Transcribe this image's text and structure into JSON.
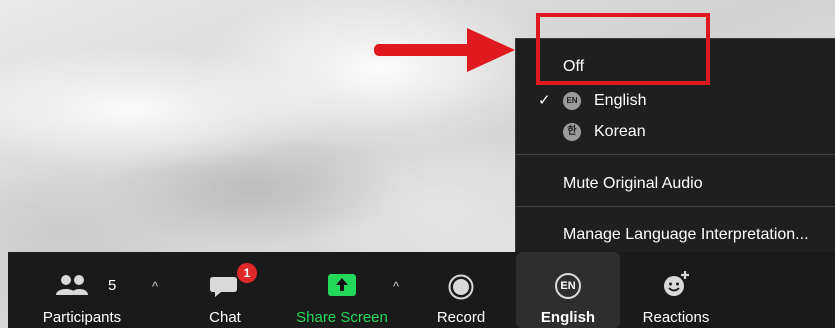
{
  "toolbar": {
    "participants": {
      "label": "Participants",
      "count": "5"
    },
    "chat": {
      "label": "Chat",
      "badge": "1"
    },
    "share_screen": {
      "label": "Share Screen"
    },
    "record": {
      "label": "Record"
    },
    "language": {
      "label": "English",
      "badge": "EN"
    },
    "reactions": {
      "label": "Reactions"
    },
    "caret": "^"
  },
  "menu": {
    "off": "Off",
    "english": {
      "badge": "EN",
      "label": "English",
      "checked": true
    },
    "korean": {
      "badge": "한",
      "label": "Korean"
    },
    "mute_original": "Mute Original Audio",
    "manage": "Manage Language Interpretation...",
    "check_mark": "✓"
  },
  "colors": {
    "toolbar_bg": "#1a1a1a",
    "menu_bg": "#1f1f1f",
    "share_green": "#23d959",
    "annotation_red": "#e0191e",
    "chat_badge_red": "#e02828"
  },
  "icons": [
    "participants-icon",
    "chat-icon",
    "share-screen-icon",
    "record-icon",
    "language-icon",
    "reactions-icon",
    "check-icon"
  ]
}
